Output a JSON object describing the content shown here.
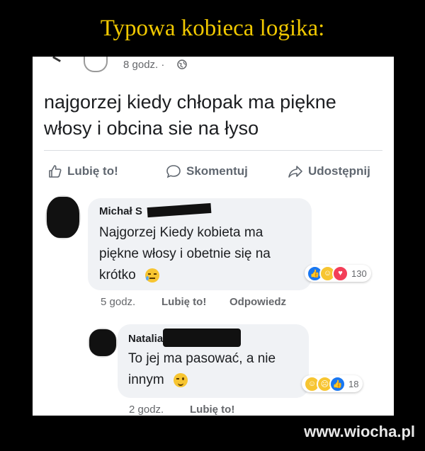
{
  "header": {
    "title": "Typowa kobieca logika:"
  },
  "post": {
    "time": "8 godz. ·",
    "text": "najgorzej kiedy chłopak ma piękne włosy i obcina sie na łyso"
  },
  "actions": {
    "like": "Lubię to!",
    "comment": "Skomentuj",
    "share": "Udostępnij"
  },
  "comments": [
    {
      "name": "Michał S",
      "text": "Najgorzej Kiedy kobieta ma piękne włosy i obetnie się na krótko",
      "reaction_count": "130",
      "time": "5 godz.",
      "like": "Lubię to!",
      "reply": "Odpowiedz"
    },
    {
      "name": "Natalia N",
      "text": "To jej ma pasować, a nie innym",
      "reaction_count": "18",
      "time": "2 godz.",
      "like": "Lubię to!"
    }
  ],
  "colors": {
    "title": "#f0c800",
    "like_blue": "#1877f2",
    "love_red": "#f33e58",
    "emoji_yellow": "#f7c531"
  },
  "watermark": "www.wiocha.pl"
}
